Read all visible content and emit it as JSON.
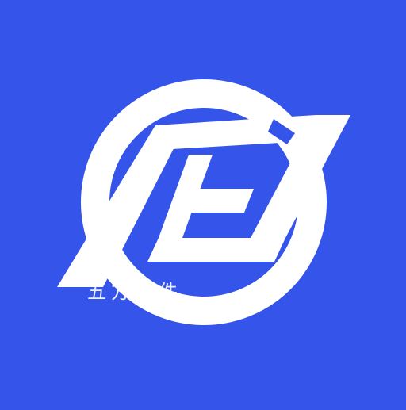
{
  "background_color": "#3554ea",
  "mark_color": "#ffffff",
  "logo": {
    "icon": "hj-monogram-logo-icon"
  },
  "watermark": {
    "text": "五方软件"
  }
}
